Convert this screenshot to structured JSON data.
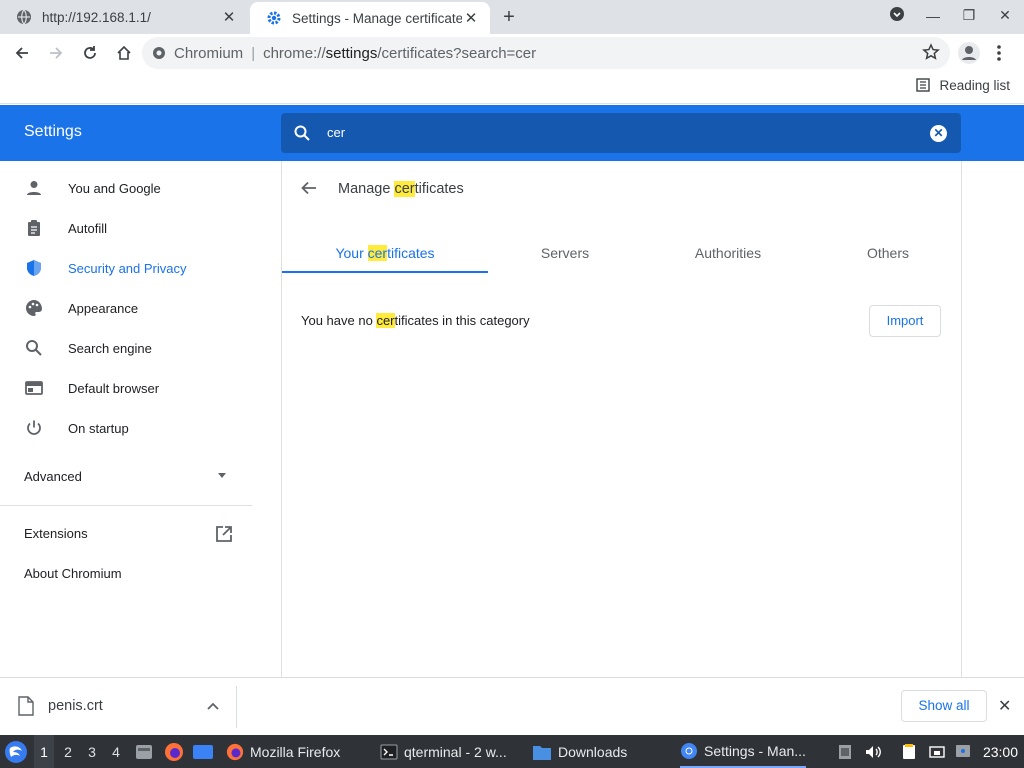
{
  "browser": {
    "tabs": [
      {
        "title": "http://192.168.1.1/",
        "active": false
      },
      {
        "title": "Settings - Manage certificates",
        "active": true
      }
    ],
    "omnibox": {
      "brand": "Chromium",
      "url_prefix": "chrome://",
      "url_host": "settings",
      "url_path": "/certificates?search=cer"
    },
    "reading_list": "Reading list"
  },
  "settings": {
    "header_title": "Settings",
    "search_value": "cer",
    "sidebar": {
      "items": [
        {
          "label": "You and Google",
          "icon": "person-icon"
        },
        {
          "label": "Autofill",
          "icon": "clipboard-icon"
        },
        {
          "label": "Security and Privacy",
          "icon": "shield-icon"
        },
        {
          "label": "Appearance",
          "icon": "palette-icon"
        },
        {
          "label": "Search engine",
          "icon": "search-icon"
        },
        {
          "label": "Default browser",
          "icon": "browser-window-icon"
        },
        {
          "label": "On startup",
          "icon": "power-icon"
        }
      ],
      "advanced": "Advanced",
      "extensions": "Extensions",
      "about": "About Chromium"
    },
    "page": {
      "title_pre": "Manage ",
      "title_hl": "cer",
      "title_post": "tificates",
      "tabs": [
        {
          "pre": "Your ",
          "hl": "cer",
          "post": "tificates"
        },
        {
          "label": "Servers"
        },
        {
          "label": "Authorities"
        },
        {
          "label": "Others"
        }
      ],
      "empty_pre": "You have no ",
      "empty_hl": "cer",
      "empty_post": "tificates in this category",
      "import_label": "Import"
    }
  },
  "downloads": {
    "file_name": "penis.crt",
    "show_all": "Show all"
  },
  "taskbar": {
    "workspaces": [
      "1",
      "2",
      "3",
      "4"
    ],
    "tasks": [
      "Mozilla Firefox",
      "qterminal - 2 w...",
      "Downloads",
      "Settings - Man..."
    ],
    "clock": "23:00"
  },
  "colors": {
    "accent": "#1a73e8",
    "highlight": "#ffeb3b"
  }
}
